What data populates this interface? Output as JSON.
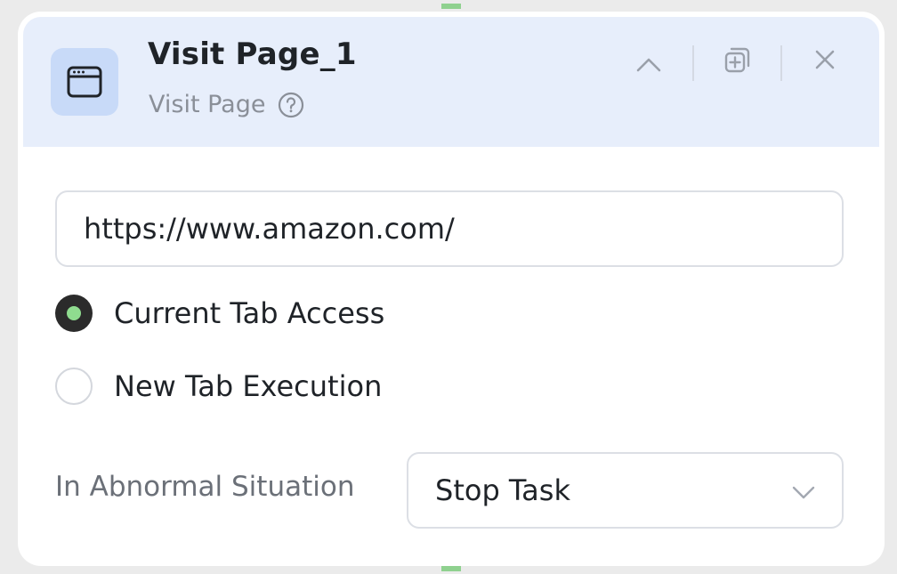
{
  "node": {
    "title": "Visit Page_1",
    "type_label": "Visit Page",
    "icon": "browser-window-icon",
    "help_icon": "question-circle-icon"
  },
  "header_actions": {
    "collapse_icon": "chevron-up-icon",
    "duplicate_icon": "duplicate-add-icon",
    "close_icon": "close-icon"
  },
  "url_input": {
    "value": "https://www.amazon.com/"
  },
  "tab_mode": {
    "options": [
      {
        "label": "Current Tab Access",
        "selected": true
      },
      {
        "label": "New Tab Execution",
        "selected": false
      }
    ]
  },
  "abnormal": {
    "label": "In Abnormal Situation",
    "selected": "Stop Task",
    "dropdown_icon": "chevron-down-icon"
  },
  "colors": {
    "header_bg": "#e7eefb",
    "icon_tile_bg": "#c8daf8",
    "radio_accent": "#8fdc8f",
    "connector": "#8fd18f"
  }
}
